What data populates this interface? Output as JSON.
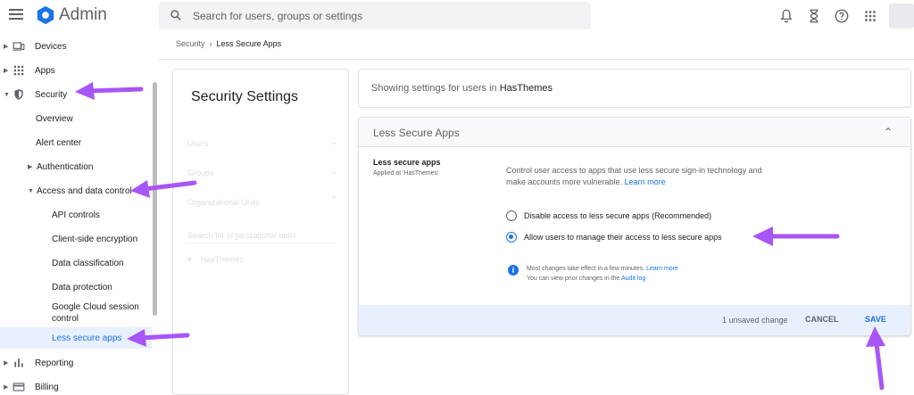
{
  "header": {
    "app_title": "Admin",
    "search_placeholder": "Search for users, groups or settings"
  },
  "sidebar": {
    "items": [
      {
        "label": "Devices"
      },
      {
        "label": "Apps"
      },
      {
        "label": "Security"
      },
      {
        "label": "Overview"
      },
      {
        "label": "Alert center"
      },
      {
        "label": "Authentication"
      },
      {
        "label": "Access and data control"
      },
      {
        "label": "API controls"
      },
      {
        "label": "Client-side encryption"
      },
      {
        "label": "Data classification"
      },
      {
        "label": "Data protection"
      },
      {
        "label": "Google Cloud session control"
      },
      {
        "label": "Less secure apps"
      },
      {
        "label": "Reporting"
      },
      {
        "label": "Billing"
      }
    ]
  },
  "breadcrumb": {
    "root": "Security",
    "sep": "›",
    "current": "Less Secure Apps"
  },
  "left_panel": {
    "title": "Security Settings",
    "rows": [
      "Users",
      "Groups",
      "Organizational Units"
    ],
    "search_placeholder": "Search for organizational units",
    "org_unit": "HasThemes"
  },
  "showing": {
    "prefix": "Showing settings for users in",
    "org": "HasThemes"
  },
  "card": {
    "title": "Less Secure Apps",
    "setting_name": "Less secure apps",
    "setting_applied": "Applied at 'HasThemes'",
    "description": "Control user access to apps that use less secure sign-in technology and make accounts more vulnerable.",
    "learn_more": "Learn more",
    "options": [
      {
        "label": "Disable access to less secure apps (Recommended)",
        "checked": false
      },
      {
        "label": "Allow users to manage their access to less secure apps",
        "checked": true
      }
    ],
    "info_line1": "Most changes take effect in a few minutes.",
    "info_learn_more": "Learn more",
    "info_line2": "You can view prior changes in the",
    "audit_log": "Audit log",
    "unsaved": "1 unsaved change",
    "cancel": "CANCEL",
    "save": "SAVE"
  },
  "colors": {
    "accent": "#1a73e8",
    "arrow": "#a855f7",
    "footer_bg": "#e8f0fe"
  }
}
